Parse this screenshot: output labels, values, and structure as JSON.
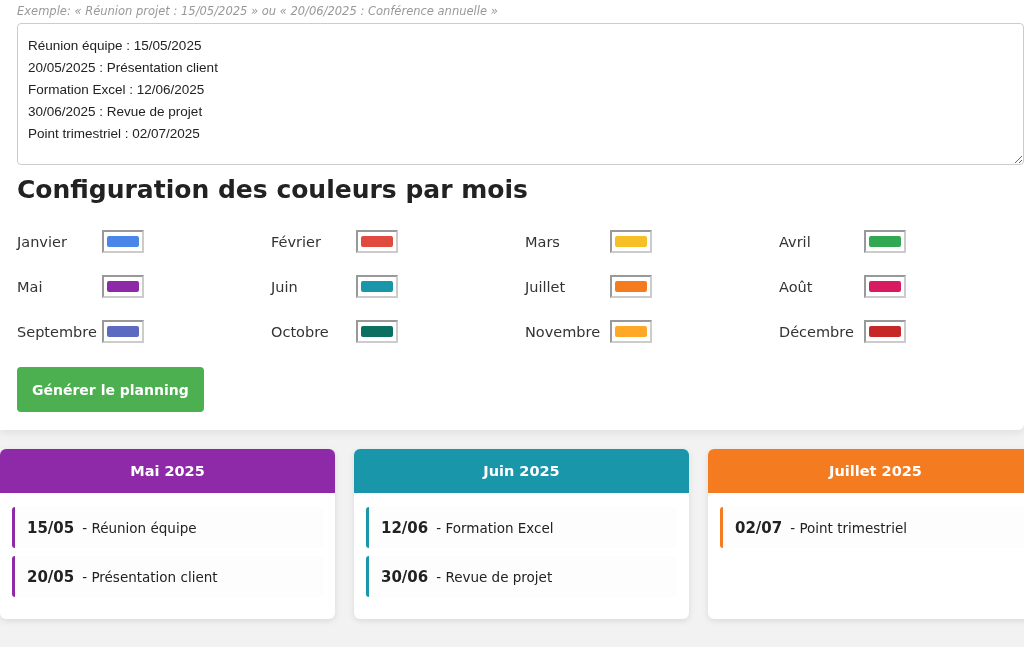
{
  "input": {
    "hint": "Exemple: « Réunion projet : 15/05/2025 » ou « 20/06/2025 : Conférence annuelle »",
    "lines": [
      "Réunion équipe : 15/05/2025",
      "20/05/2025 : Présentation client",
      "Formation Excel : 12/06/2025",
      "30/06/2025 : Revue de projet",
      "Point trimestriel : 02/07/2025"
    ]
  },
  "colors_title": "Configuration des couleurs par mois",
  "months": [
    {
      "label": "Janvier",
      "color": "#4a86e8"
    },
    {
      "label": "Février",
      "color": "#e04a3f"
    },
    {
      "label": "Mars",
      "color": "#f6bf26"
    },
    {
      "label": "Avril",
      "color": "#33a852"
    },
    {
      "label": "Mai",
      "color": "#8e2aa8"
    },
    {
      "label": "Juin",
      "color": "#1a96aa"
    },
    {
      "label": "Juillet",
      "color": "#f47b20"
    },
    {
      "label": "Août",
      "color": "#d81b60"
    },
    {
      "label": "Septembre",
      "color": "#5c6bc0"
    },
    {
      "label": "Octobre",
      "color": "#0b7060"
    },
    {
      "label": "Novembre",
      "color": "#ffa726"
    },
    {
      "label": "Décembre",
      "color": "#c62828"
    }
  ],
  "generate_button": "Générer le planning",
  "cards": [
    {
      "title": "Mai 2025",
      "color": "#8e2aa8",
      "events": [
        {
          "date": "15/05",
          "label": "- Réunion équipe"
        },
        {
          "date": "20/05",
          "label": "- Présentation client"
        }
      ]
    },
    {
      "title": "Juin 2025",
      "color": "#1a96aa",
      "events": [
        {
          "date": "12/06",
          "label": "- Formation Excel"
        },
        {
          "date": "30/06",
          "label": "- Revue de projet"
        }
      ]
    },
    {
      "title": "Juillet 2025",
      "color": "#f47b20",
      "events": [
        {
          "date": "02/07",
          "label": "- Point trimestriel"
        }
      ]
    }
  ]
}
